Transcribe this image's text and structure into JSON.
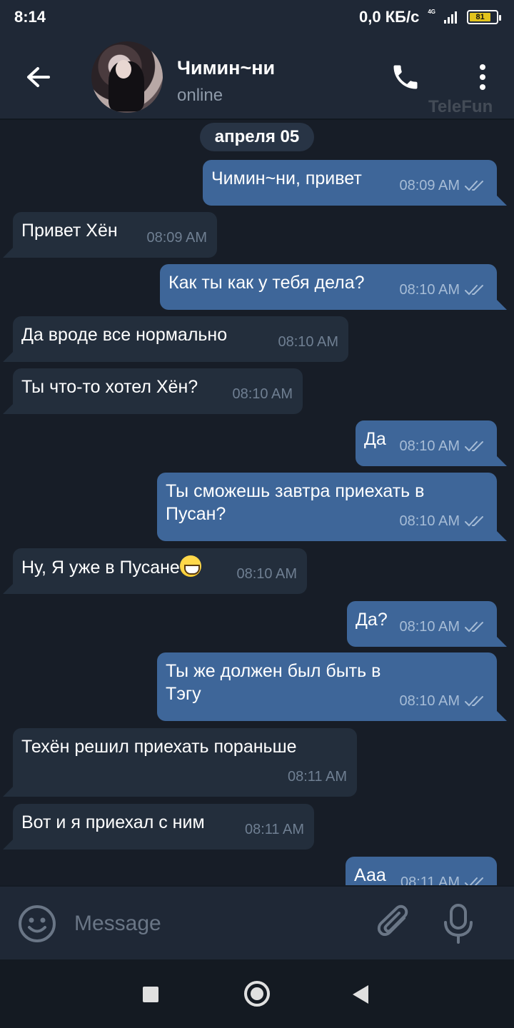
{
  "status_bar": {
    "time": "8:14",
    "network_speed": "0,0 КБ/с",
    "network_type": "4G",
    "battery_level": "81"
  },
  "header": {
    "contact_name": "Чимин~ни",
    "contact_status": "online",
    "watermark": "TeleFun"
  },
  "chat": {
    "date_label": "апреля 05",
    "messages": [
      {
        "direction": "out",
        "text": "Чимин~ни, привет",
        "time": "08:09 AM",
        "read": true
      },
      {
        "direction": "in",
        "text": "Привет Хён",
        "time": "08:09 AM"
      },
      {
        "direction": "out",
        "text": "Как ты как у тебя дела?",
        "time": "08:10 AM",
        "read": true
      },
      {
        "direction": "in",
        "text": "Да вроде все нормально",
        "time": "08:10 AM"
      },
      {
        "direction": "in",
        "text": "Ты что-то хотел Хён?",
        "time": "08:10 AM"
      },
      {
        "direction": "out",
        "text": "Да",
        "time": "08:10 AM",
        "read": true
      },
      {
        "direction": "out",
        "text_line1": "Ты сможешь завтра приехать в",
        "text_line2": "Пусан?",
        "time": "08:10 AM",
        "read": true
      },
      {
        "direction": "in",
        "text": "Ну, Я уже в Пусане",
        "emoji": "grinning-face",
        "time": "08:10 AM"
      },
      {
        "direction": "out",
        "text": "Да?",
        "time": "08:10 AM",
        "read": true
      },
      {
        "direction": "out",
        "text_line1": "Ты же должен был быть в",
        "text_line2": "Тэгу",
        "time": "08:10 AM",
        "read": true
      },
      {
        "direction": "in",
        "text": "Техён решил приехать пораньше",
        "time": "08:11 AM"
      },
      {
        "direction": "in",
        "text": "Вот и я приехал с ним",
        "time": "08:11 AM"
      },
      {
        "direction": "out",
        "text": "Ааа",
        "time": "08:11 AM",
        "read": true
      }
    ]
  },
  "input": {
    "placeholder": "Message",
    "value": ""
  },
  "icons": {
    "back": "arrow-left-icon",
    "call": "phone-icon",
    "menu": "more-vertical-icon",
    "emoji": "smile-icon",
    "attach": "paperclip-icon",
    "mic": "microphone-icon",
    "read_receipt": "double-check-icon"
  },
  "colors": {
    "outgoing_bubble": "#3e6699",
    "incoming_bubble": "#232e3c",
    "background": "#171d27",
    "header": "#1f2836"
  }
}
